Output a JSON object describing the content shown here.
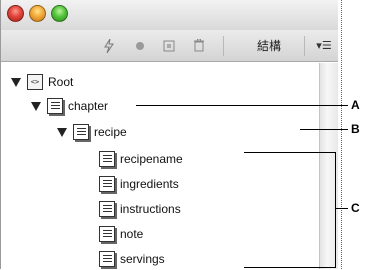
{
  "window": {
    "title_buttons": [
      "close",
      "minimize",
      "zoom"
    ],
    "toolbar": {
      "icons": [
        "lightning-icon",
        "circle-icon",
        "square-icon",
        "trash-icon"
      ],
      "label": "結構",
      "menu_icon": "▾☰"
    }
  },
  "tree": {
    "root": {
      "label": "Root",
      "icon": "<>"
    },
    "chapter": {
      "label": "chapter"
    },
    "recipe": {
      "label": "recipe"
    },
    "children": [
      {
        "label": "recipename"
      },
      {
        "label": "ingredients"
      },
      {
        "label": "instructions"
      },
      {
        "label": "note"
      },
      {
        "label": "servings"
      }
    ]
  },
  "callouts": {
    "a": "A",
    "b": "B",
    "c": "C"
  },
  "colors": {
    "accent_red": "#e0443a",
    "accent_yellow": "#f2a93a",
    "accent_green": "#55c43c"
  }
}
